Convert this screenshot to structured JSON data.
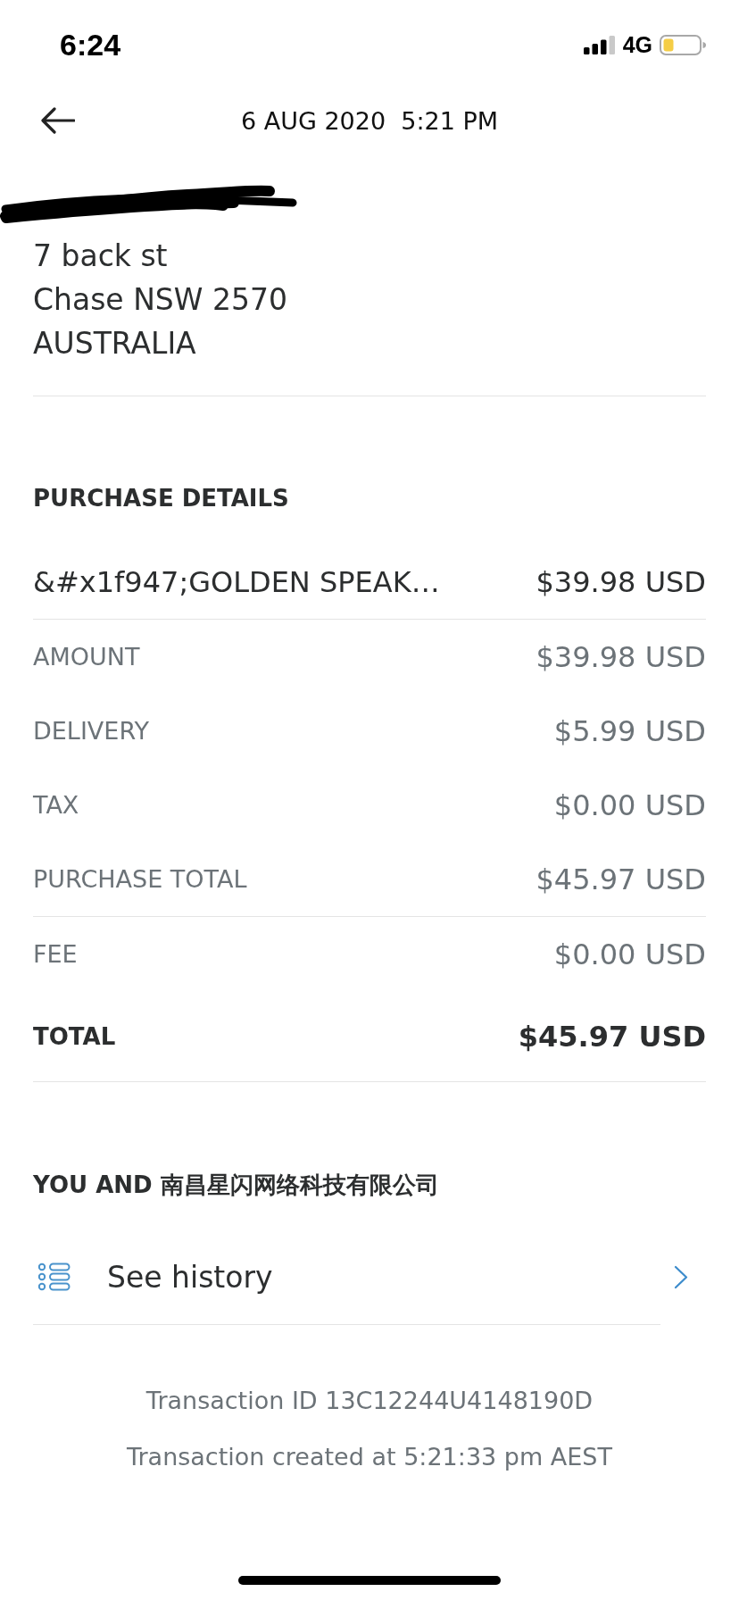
{
  "status_bar": {
    "time": "6:24",
    "network": "4G"
  },
  "header": {
    "title": "6 AUG 2020  5:21 PM"
  },
  "shipping": {
    "address_lines": [
      "7 back st",
      "Chase NSW 2570",
      "AUSTRALIA"
    ]
  },
  "purchase_details": {
    "heading": "PURCHASE DETAILS",
    "items": [
      {
        "name": "&#x1f947;GOLDEN SPEAK…",
        "price": "$39.98 USD"
      }
    ],
    "summary_groups": [
      {
        "rows": [
          {
            "kind": "line",
            "label": "AMOUNT",
            "value": "$39.98 USD"
          },
          {
            "kind": "line",
            "label": "DELIVERY",
            "value": "$5.99 USD"
          },
          {
            "kind": "line",
            "label": "TAX",
            "value": "$0.00 USD"
          },
          {
            "kind": "line",
            "label": "PURCHASE TOTAL",
            "value": "$45.97 USD"
          }
        ]
      },
      {
        "rows": [
          {
            "kind": "line",
            "label": "FEE",
            "value": "$0.00 USD"
          },
          {
            "kind": "total",
            "label": "TOTAL",
            "value": "$45.97 USD"
          }
        ]
      }
    ]
  },
  "counterparty": {
    "heading": "YOU AND 南昌星闪网络科技有限公司",
    "links": [
      {
        "label": "See history"
      }
    ]
  },
  "transaction": {
    "id_line": "Transaction ID 13C12244U4148190D",
    "created_line": "Transaction created at 5:21:33 pm AEST"
  }
}
